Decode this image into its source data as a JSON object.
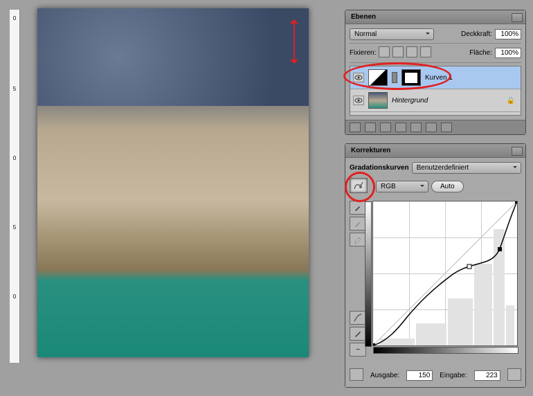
{
  "layers_panel": {
    "title": "Ebenen",
    "blend_mode": "Normal",
    "opacity_label": "Deckkraft:",
    "opacity_value": "100%",
    "lock_label": "Fixieren:",
    "fill_label": "Fläche:",
    "fill_value": "100%",
    "layers": [
      {
        "name": "Kurven 1",
        "selected": true,
        "type": "adjustment"
      },
      {
        "name": "Hintergrund",
        "selected": false,
        "type": "background"
      }
    ]
  },
  "adjustments_panel": {
    "title": "Korrekturen",
    "type_label": "Gradationskurven",
    "preset": "Benutzerdefiniert",
    "channel": "RGB",
    "auto_label": "Auto",
    "output_label": "Ausgabe:",
    "output_value": "150",
    "input_label": "Eingabe:",
    "input_value": "223"
  },
  "chart_data": {
    "type": "line",
    "title": "Gradationskurve",
    "xlabel": "Eingabe",
    "ylabel": "Ausgabe",
    "xlim": [
      0,
      255
    ],
    "ylim": [
      0,
      255
    ],
    "series": [
      {
        "name": "diagonal",
        "x": [
          0,
          255
        ],
        "y": [
          0,
          255
        ]
      },
      {
        "name": "curve",
        "x": [
          0,
          30,
          60,
          100,
          140,
          170,
          195,
          215,
          225,
          240,
          255
        ],
        "y": [
          0,
          10,
          50,
          95,
          125,
          140,
          148,
          155,
          170,
          220,
          255
        ]
      }
    ],
    "control_points": [
      {
        "x": 0,
        "y": 0
      },
      {
        "x": 170,
        "y": 140
      },
      {
        "x": 225,
        "y": 170
      },
      {
        "x": 255,
        "y": 255
      }
    ]
  }
}
